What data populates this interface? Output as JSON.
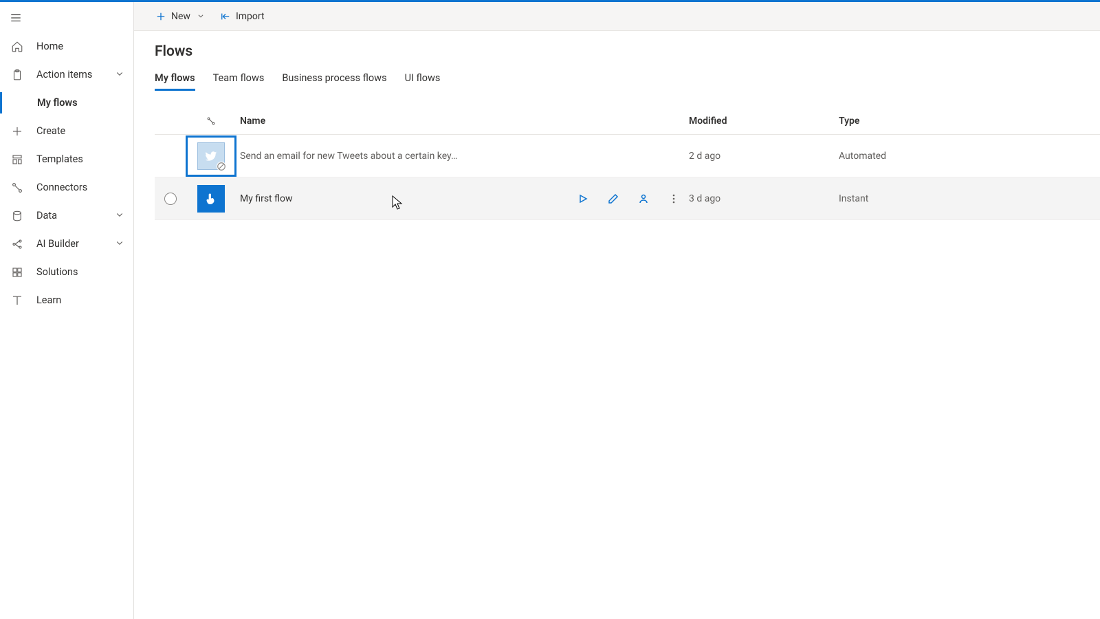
{
  "sidebar": {
    "items": [
      {
        "label": "Home"
      },
      {
        "label": "Action items"
      },
      {
        "label": "My flows"
      },
      {
        "label": "Create"
      },
      {
        "label": "Templates"
      },
      {
        "label": "Connectors"
      },
      {
        "label": "Data"
      },
      {
        "label": "AI Builder"
      },
      {
        "label": "Solutions"
      },
      {
        "label": "Learn"
      }
    ]
  },
  "command_bar": {
    "new_label": "New",
    "import_label": "Import"
  },
  "page": {
    "title": "Flows"
  },
  "tabs": [
    {
      "label": "My flows"
    },
    {
      "label": "Team flows"
    },
    {
      "label": "Business process flows"
    },
    {
      "label": "UI flows"
    }
  ],
  "table": {
    "headers": {
      "name": "Name",
      "modified": "Modified",
      "type": "Type"
    },
    "rows": [
      {
        "name": "Send an email for new Tweets about a certain key…",
        "modified": "2 d ago",
        "type": "Automated"
      },
      {
        "name": "My first flow",
        "modified": "3 d ago",
        "type": "Instant"
      }
    ]
  }
}
